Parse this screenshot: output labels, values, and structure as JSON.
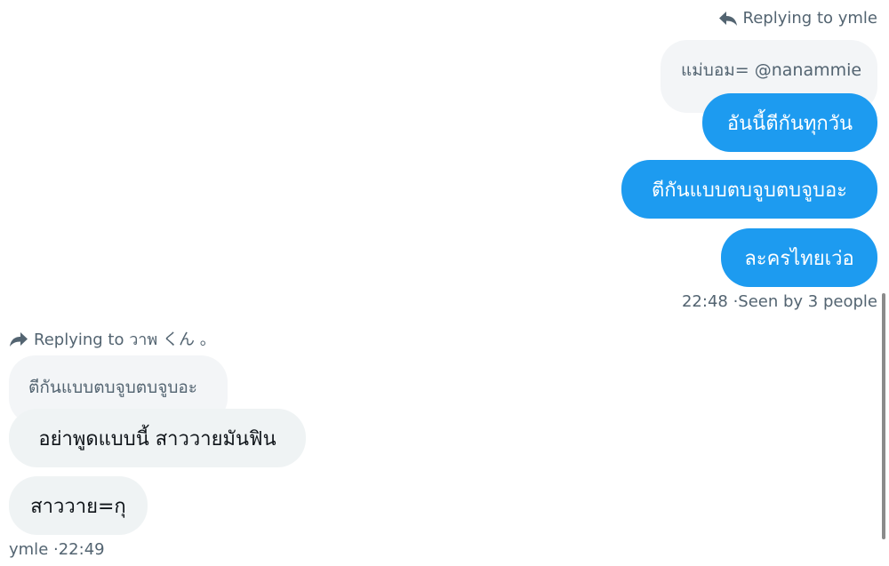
{
  "outgoing": {
    "reply_header": {
      "icon": "reply-arrow-icon",
      "text": "Replying to ymle"
    },
    "quote_text": "แม่บอม= @nanammie",
    "messages": [
      "อันนี้ตีกันทุกวัน",
      "ตีกันแบบตบจูบตบจูบอะ",
      "ละครไทยเว่อ"
    ],
    "meta": {
      "time": "22:48",
      "seen": "·Seen by 3 people"
    }
  },
  "incoming": {
    "reply_header": {
      "icon": "reply-forward-icon",
      "text": "Replying to วาพ くん 。"
    },
    "quote_text": "ตีกันแบบตบจูบตบจูบอะ",
    "messages": [
      "อย่าพูดแบบนี้ สาววายมันฟิน",
      "สาววาย=กุ"
    ],
    "meta": {
      "sender": "ymle",
      "time": "·22:49"
    }
  },
  "colors": {
    "outgoing_bubble": "#1d9bf0",
    "incoming_bubble": "#eff3f4",
    "quote_bubble": "#f3f5f7",
    "secondary_text": "#536471"
  }
}
